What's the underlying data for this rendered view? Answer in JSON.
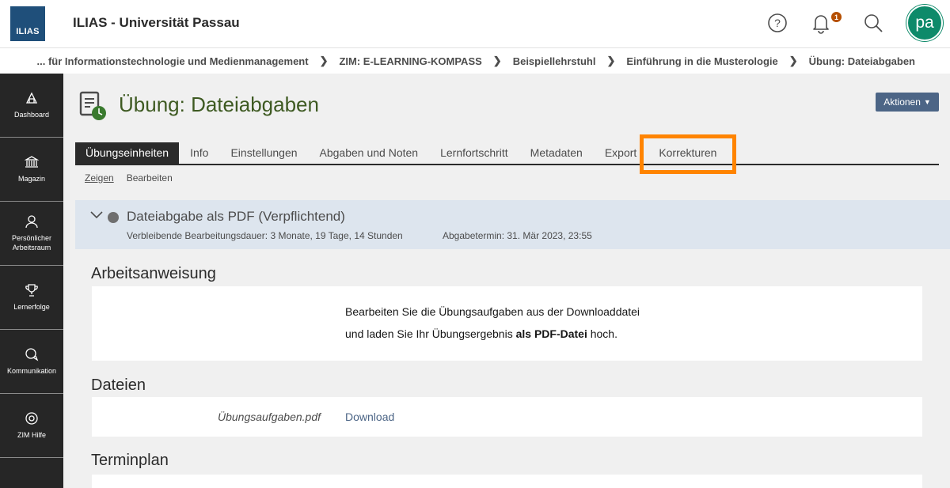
{
  "header": {
    "logo_text": "ILIAS",
    "app_title": "ILIAS - Universität Passau",
    "notification_count": "1",
    "avatar_initials": "pa"
  },
  "breadcrumb": [
    "... für Informationstechnologie und Medienmanagement",
    "ZIM: E-LEARNING-KOMPASS",
    "Beispiellehrstuhl",
    "Einführung in die Musterologie",
    "Übung: Dateiabgaben"
  ],
  "sidebar": {
    "items": [
      {
        "label": "Dashboard",
        "icon": "dashboard-icon"
      },
      {
        "label": "Magazin",
        "icon": "building-icon"
      },
      {
        "label": "Persönlicher Arbeitsraum",
        "icon": "person-icon"
      },
      {
        "label": "Lernerfolge",
        "icon": "trophy-icon"
      },
      {
        "label": "Kommunikation",
        "icon": "chat-icon"
      },
      {
        "label": "ZIM Hilfe",
        "icon": "lifebuoy-icon"
      }
    ]
  },
  "page": {
    "title": "Übung: Dateiabgaben",
    "actions_label": "Aktionen"
  },
  "tabs": [
    {
      "label": "Übungseinheiten",
      "active": true
    },
    {
      "label": "Info",
      "active": false
    },
    {
      "label": "Einstellungen",
      "active": false
    },
    {
      "label": "Abgaben und Noten",
      "active": false
    },
    {
      "label": "Lernfortschritt",
      "active": false
    },
    {
      "label": "Metadaten",
      "active": false
    },
    {
      "label": "Export",
      "active": false
    },
    {
      "label": "Korrekturen",
      "active": false,
      "highlighted": true
    }
  ],
  "subtabs": [
    {
      "label": "Zeigen",
      "active": true
    },
    {
      "label": "Bearbeiten",
      "active": false
    }
  ],
  "assignment": {
    "title": "Dateiabgabe als PDF (Verpflichtend)",
    "remaining": "Verbleibende Bearbeitungsdauer: 3 Monate, 19 Tage, 14 Stunden",
    "deadline": "Abgabetermin: 31. Mär 2023, 23:55"
  },
  "sections": {
    "instructions_title": "Arbeitsanweisung",
    "instructions_line1": "Bearbeiten Sie die Übungsaufgaben aus der Downloaddatei",
    "instructions_line2_start": "und laden Sie Ihr Übungsergebnis ",
    "instructions_line2_bold": "als PDF-Datei",
    "instructions_line2_end": " hoch.",
    "files_title": "Dateien",
    "file_name": "Übungsaufgaben.pdf",
    "download_label": "Download",
    "schedule_title": "Terminplan"
  },
  "colors": {
    "highlight": "#ff8400",
    "title_green": "#3e5a22",
    "avatar": "#0e8a6a",
    "badge": "#b54f00"
  }
}
